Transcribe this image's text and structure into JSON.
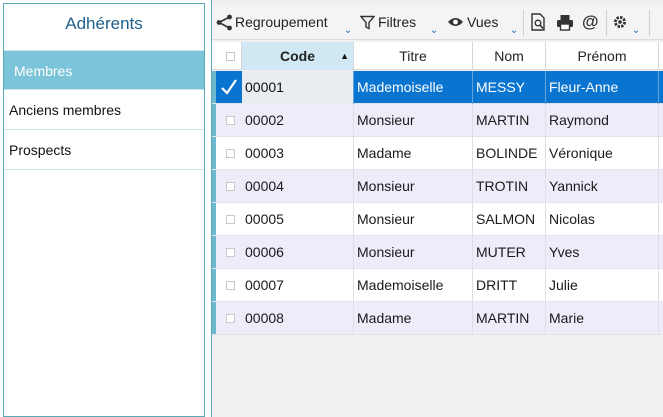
{
  "left": {
    "title": "Adhérents",
    "items": [
      {
        "label": "Membres",
        "active": true
      },
      {
        "label": "Anciens membres",
        "active": false
      },
      {
        "label": "Prospects",
        "active": false
      }
    ]
  },
  "toolbar": {
    "grouping_label": "Regroupement",
    "filters_label": "Filtres",
    "views_label": "Vues",
    "accent_color": "#1f6fb8"
  },
  "grid": {
    "columns": [
      "Code",
      "Titre",
      "Nom",
      "Prénom"
    ],
    "sorted_column": "Code",
    "sort_direction": "ascending",
    "selected_row_color": "#0a74d1",
    "rows": [
      {
        "code": "00001",
        "titre": "Mademoiselle",
        "nom": "MESSY",
        "prenom": "Fleur-Anne",
        "selected": true
      },
      {
        "code": "00002",
        "titre": "Monsieur",
        "nom": "MARTIN",
        "prenom": "Raymond",
        "selected": false
      },
      {
        "code": "00003",
        "titre": "Madame",
        "nom": "BOLINDE",
        "prenom": "Véronique",
        "selected": false
      },
      {
        "code": "00004",
        "titre": "Monsieur",
        "nom": "TROTIN",
        "prenom": "Yannick",
        "selected": false
      },
      {
        "code": "00005",
        "titre": "Monsieur",
        "nom": "SALMON",
        "prenom": "Nicolas",
        "selected": false
      },
      {
        "code": "00006",
        "titre": "Monsieur",
        "nom": "MUTER",
        "prenom": "Yves",
        "selected": false
      },
      {
        "code": "00007",
        "titre": "Mademoiselle",
        "nom": "DRITT",
        "prenom": "Julie",
        "selected": false
      },
      {
        "code": "00008",
        "titre": "Madame",
        "nom": "MARTIN",
        "prenom": "Marie",
        "selected": false
      }
    ]
  }
}
